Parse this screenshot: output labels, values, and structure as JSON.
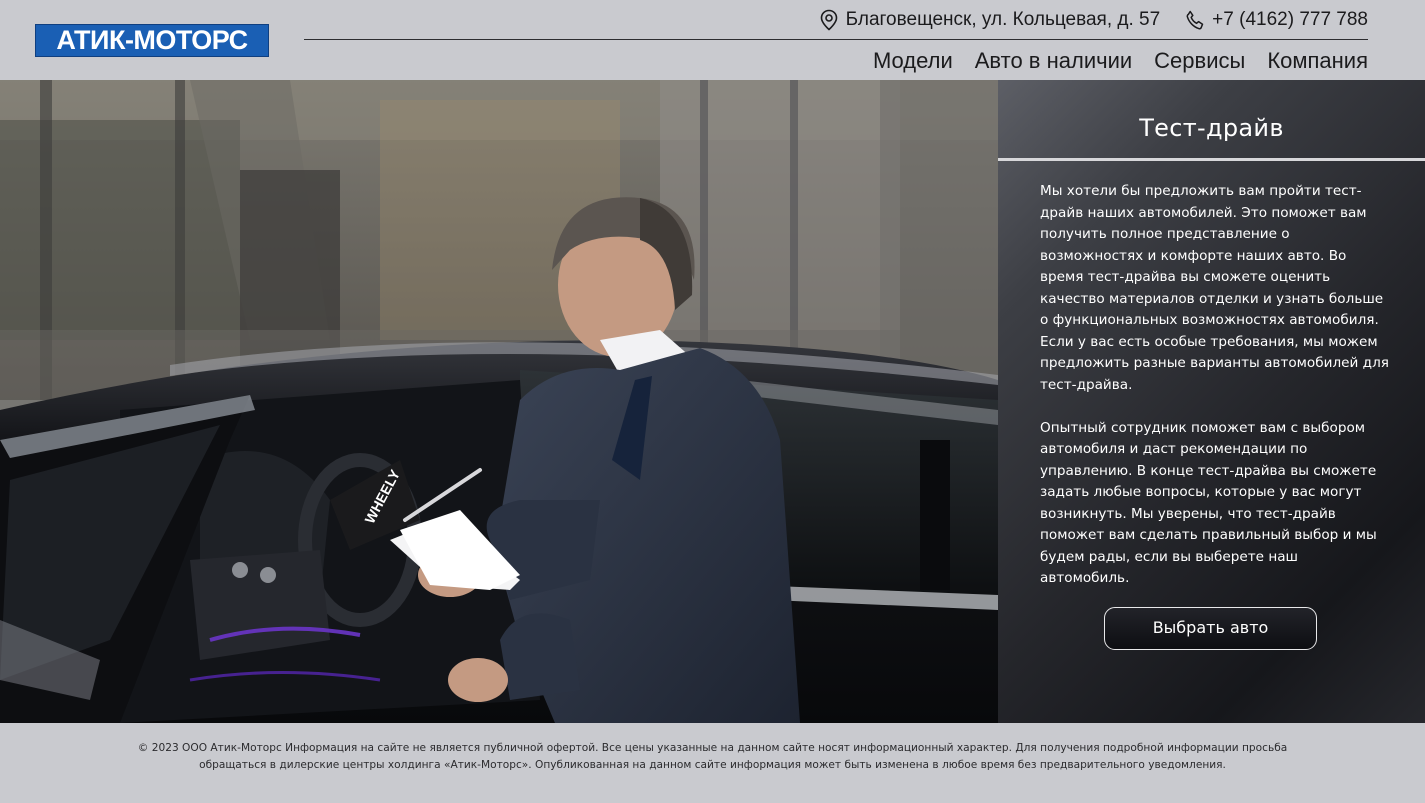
{
  "header": {
    "logo": "АТИК-МОТОРС",
    "address": "Благовещенск, ул. Кольцевая, д. 57",
    "phone": "+7 (4162) 777 788",
    "nav": [
      {
        "label": "Модели"
      },
      {
        "label": "Авто в наличии"
      },
      {
        "label": "Сервисы"
      },
      {
        "label": "Компания"
      }
    ]
  },
  "hero": {
    "folder_text": "WHEELY"
  },
  "panel": {
    "title": "Тест-драйв",
    "paragraphs": [
      "Мы хотели бы предложить вам пройти тест-драйв наших автомобилей. Это поможет вам получить полное представление о возможностях и комфорте наших авто. Во время тест-драйва вы сможете оценить качество материалов отделки и узнать больше о функциональных возможностях автомобиля. Если у вас есть особые требования, мы можем предложить разные варианты автомобилей для тест-драйва.",
      "Опытный сотрудник поможет вам с выбором автомобиля и даст рекомендации по управлению. В конце тест-драйва вы сможете задать любые вопросы, которые у вас могут возникнуть. Мы уверены, что тест-драйв поможет вам сделать правильный выбор и мы будем рады, если вы выберете наш автомобиль."
    ],
    "button_label": "Выбрать авто"
  },
  "footer": {
    "text": "© 2023 ООО Атик-Моторс Информация на сайте не является публичной офертой. Все цены указанные на данном сайте носят информационный характер. Для получения подробной информации просьба обращаться в дилерские центры холдинга «Атик-Моторс». Опубликованная на данном сайте информация может быть изменена в любое время без предварительного уведомления."
  },
  "icons": {
    "location": "map-pin-icon",
    "phone": "phone-icon"
  },
  "colors": {
    "logo_bg": "#1a5fb4",
    "page_bg": "#c9cacf",
    "panel_bg": "#25262b"
  }
}
